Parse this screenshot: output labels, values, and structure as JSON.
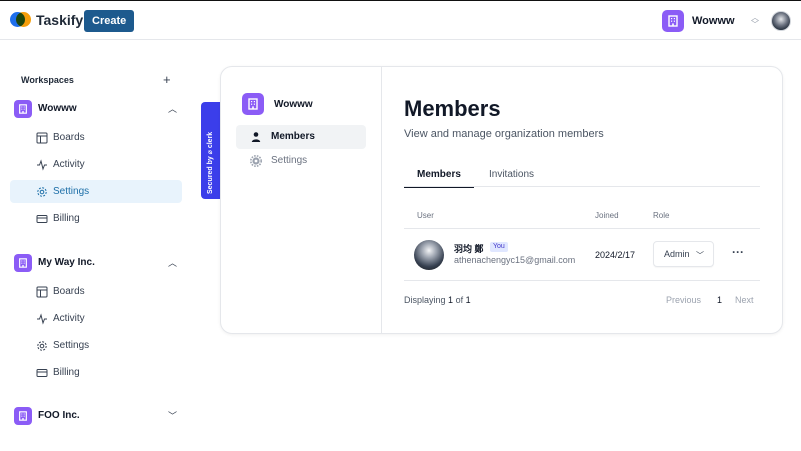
{
  "app": {
    "name": "Taskify",
    "create_label": "Create"
  },
  "org_switcher": {
    "name": "Wowww"
  },
  "sidebar": {
    "heading": "Workspaces",
    "orgs": [
      {
        "name": "Wowww",
        "expanded": true,
        "items": [
          {
            "label": "Boards",
            "icon": "layout-icon"
          },
          {
            "label": "Activity",
            "icon": "activity-icon"
          },
          {
            "label": "Settings",
            "icon": "settings-icon",
            "active": true
          },
          {
            "label": "Billing",
            "icon": "credit-card-icon"
          }
        ]
      },
      {
        "name": "My Way Inc.",
        "expanded": true,
        "items": [
          {
            "label": "Boards",
            "icon": "layout-icon"
          },
          {
            "label": "Activity",
            "icon": "activity-icon"
          },
          {
            "label": "Settings",
            "icon": "settings-icon"
          },
          {
            "label": "Billing",
            "icon": "credit-card-icon"
          }
        ]
      },
      {
        "name": "FOO Inc.",
        "expanded": false,
        "items": []
      }
    ]
  },
  "clerk_badge": {
    "text": "Secured by ⌀ clerk"
  },
  "org_profile": {
    "org_name": "Wowww",
    "nav": [
      {
        "label": "Members",
        "active": true
      },
      {
        "label": "Settings"
      }
    ],
    "title": "Members",
    "subtitle": "View and manage organization members",
    "tabs": [
      {
        "label": "Members",
        "active": true
      },
      {
        "label": "Invitations"
      }
    ],
    "columns": {
      "user": "User",
      "joined": "Joined",
      "role": "Role"
    },
    "members": [
      {
        "name": "羽均 鄭",
        "badge": "You",
        "email": "athenachengyc15@gmail.com",
        "joined": "2024/2/17",
        "role": "Admin"
      }
    ],
    "footer": {
      "prefix": "Displaying",
      "from": "1",
      "of": "of",
      "to": "1"
    },
    "pagination": {
      "previous": "Previous",
      "page": "1",
      "next": "Next"
    }
  },
  "colors": {
    "accent": "#1d5a8e",
    "org_tile": "#8b5cf6",
    "active_nav_bg": "#e8f3fc",
    "clerk": "#3b3eea"
  }
}
